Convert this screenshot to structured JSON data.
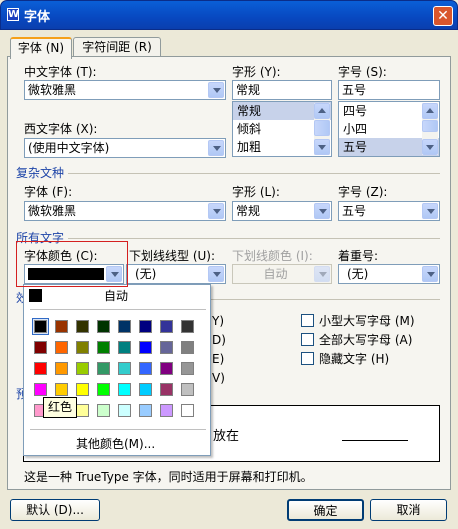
{
  "title": "字体",
  "app_icon": "W",
  "tabs": [
    "字体 (N)",
    "字符间距 (R)"
  ],
  "chinese_font": {
    "label": "中文字体 (T):",
    "value": "微软雅黑"
  },
  "western_font": {
    "label": "西文字体 (X):",
    "value": "(使用中文字体)"
  },
  "font_style": {
    "label": "字形 (Y):",
    "value": "常规",
    "options": [
      "常规",
      "倾斜",
      "加粗"
    ]
  },
  "font_size": {
    "label": "字号 (S):",
    "value": "五号",
    "options": [
      "四号",
      "小四",
      "五号"
    ]
  },
  "complex_section": "复杂文种",
  "complex_font": {
    "label": "字体 (F):",
    "value": "微软雅黑"
  },
  "complex_style": {
    "label": "字形 (L):",
    "value": "常规"
  },
  "complex_size": {
    "label": "字号 (Z):",
    "value": "五号"
  },
  "all_text_section": "所有文字",
  "font_color": {
    "label": "字体颜色 (C):",
    "value_color": "#000000"
  },
  "underline_type": {
    "label": "下划线线型 (U):",
    "value": "(无)"
  },
  "underline_color": {
    "label": "下划线颜色 (I):",
    "value": "自动"
  },
  "emphasis": {
    "label": "着重号:",
    "value": "(无)"
  },
  "effects_section": "效",
  "effects_right": [
    "小型大写字母 (M)",
    "全部大写字母 (A)",
    "隐藏文字 (H)"
  ],
  "effects_left_glyphs": [
    "Y)",
    "D)",
    "E)",
    "V)"
  ],
  "preview_section": "预",
  "preview_text": "放在",
  "note": "这是一种 TrueType 字体，同时适用于屏幕和打印机。",
  "buttons": {
    "default": "默认 (D)...",
    "ok": "确定",
    "cancel": "取消"
  },
  "palette": {
    "auto_label": "自动",
    "more_label": "其他颜色(M)...",
    "tooltip": "红色",
    "rows": [
      [
        "#000000",
        "#993300",
        "#333300",
        "#003300",
        "#003366",
        "#000080",
        "#333399",
        "#333333"
      ],
      [
        "#800000",
        "#ff6600",
        "#808000",
        "#008000",
        "#008080",
        "#0000ff",
        "#666699",
        "#808080"
      ],
      [
        "#ff0000",
        "#ff9900",
        "#99cc00",
        "#339966",
        "#33cccc",
        "#3366ff",
        "#800080",
        "#969696"
      ],
      [
        "#ff00ff",
        "#ffcc00",
        "#ffff00",
        "#00ff00",
        "#00ffff",
        "#00ccff",
        "#993366",
        "#c0c0c0"
      ],
      [
        "#ff99cc",
        "#ffcc99",
        "#ffff99",
        "#ccffcc",
        "#ccffff",
        "#99ccff",
        "#cc99ff",
        "#ffffff"
      ]
    ]
  }
}
